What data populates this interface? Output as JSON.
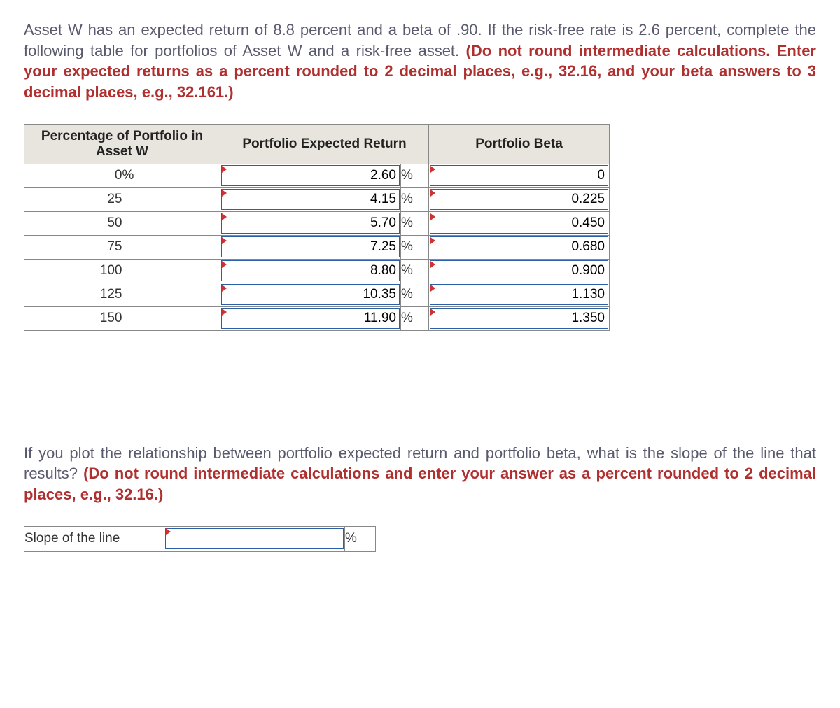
{
  "q1_part1": "Asset W has an expected return of 8.8 percent and a beta of .90. If the risk-free rate is 2.6 percent, complete the following table for portfolios of Asset W and a risk-free asset. ",
  "q1_emph": "(Do not round intermediate calculations. Enter your expected returns as a percent rounded to 2 decimal places, e.g., 32.16, and your beta answers to 3 decimal places, e.g., 32.161.)",
  "headers": {
    "pct": "Percentage of Portfolio in Asset W",
    "ret": "Portfolio Expected Return",
    "beta": "Portfolio Beta"
  },
  "rows": [
    {
      "pct": "0",
      "unit": "%",
      "ret": "2.60",
      "retunit": "%",
      "beta": "0"
    },
    {
      "pct": "25",
      "unit": "",
      "ret": "4.15",
      "retunit": "%",
      "beta": "0.225"
    },
    {
      "pct": "50",
      "unit": "",
      "ret": "5.70",
      "retunit": "%",
      "beta": "0.450"
    },
    {
      "pct": "75",
      "unit": "",
      "ret": "7.25",
      "retunit": "%",
      "beta": "0.680"
    },
    {
      "pct": "100",
      "unit": "",
      "ret": "8.80",
      "retunit": "%",
      "beta": "0.900"
    },
    {
      "pct": "125",
      "unit": "",
      "ret": "10.35",
      "retunit": "%",
      "beta": "1.130"
    },
    {
      "pct": "150",
      "unit": "",
      "ret": "11.90",
      "retunit": "%",
      "beta": "1.350"
    }
  ],
  "q2_part1": "If you plot the relationship between portfolio expected return and portfolio beta, what is the slope of the line that results? ",
  "q2_emph": "(Do not round intermediate calculations and enter your answer as a percent rounded to 2 decimal places, e.g., 32.16.)",
  "slope_label": "Slope of the line",
  "slope_value": "",
  "slope_unit": "%"
}
